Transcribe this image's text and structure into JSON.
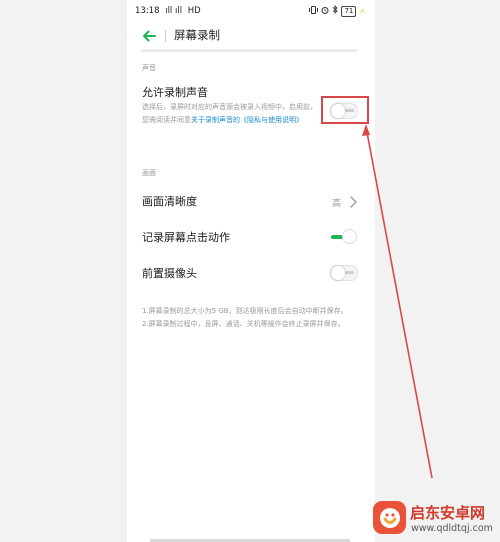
{
  "status_bar": {
    "time": "13:18",
    "network": "ıll ıll",
    "hd": "HD",
    "battery": "71"
  },
  "header": {
    "title": "屏幕录制"
  },
  "sections": {
    "sound_label": "声音",
    "picture_label": "画面"
  },
  "allow_sound": {
    "title": "允许录制声音",
    "description": "选择后，录屏时对应的声音源会被录入视频中，启用前，您需阅读并同意",
    "link": "关于录制声音的《隐私与使用说明》",
    "enabled": false
  },
  "settings": {
    "quality_title": "画面清晰度",
    "quality_value": "高",
    "tap_title": "记录屏幕点击动作",
    "tap_enabled": true,
    "camera_title": "前置摄像头",
    "camera_enabled": false
  },
  "notes": [
    "1.屏幕录制的总大小为5 GB，到达极限长度后会自动中断并保存。",
    "2.屏幕录制过程中，息屏、通话、关机等操作会终止录屏并保存。"
  ],
  "watermark": {
    "title": "启东安卓网",
    "url": "www.qdldtqj.com"
  },
  "colors": {
    "accent_green": "#1fb35a",
    "link_blue": "#1a8cd8",
    "annotation_red": "#d94848"
  }
}
